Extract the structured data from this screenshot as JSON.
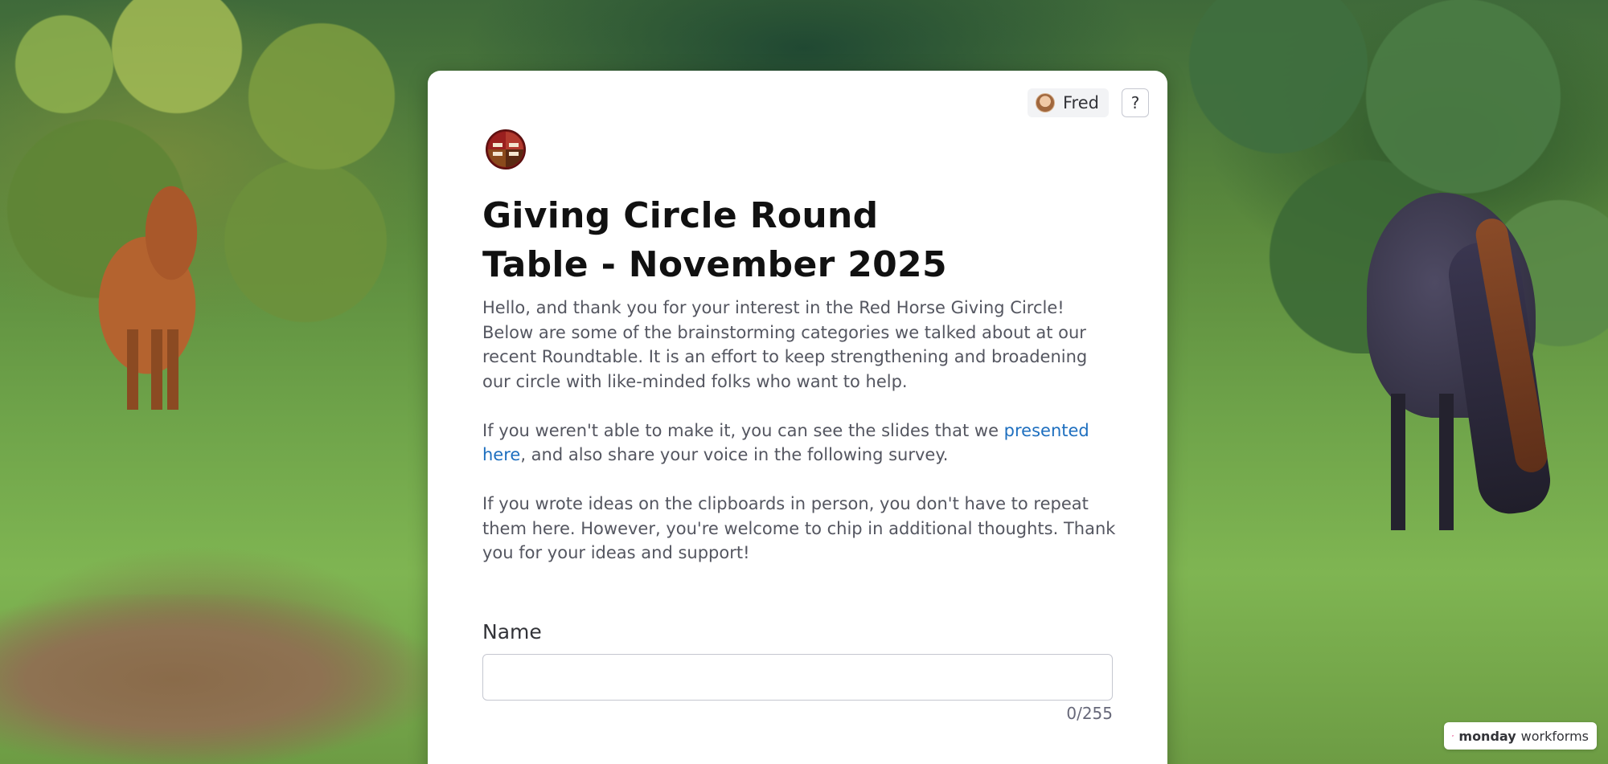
{
  "header": {
    "user_name": "Fred",
    "help_label": "?"
  },
  "form": {
    "title": "Giving Circle Round Table - November 2025",
    "paragraphs": [
      "Hello, and thank you for your interest in the Red Horse Giving Circle! Below are some of the brainstorming categories we talked about at our recent Roundtable. It is an effort to keep strengthening and broadening our circle with like-minded folks who want to help.",
      "If you weren't able to make it, you can see the slides that we ",
      "presented here",
      ", and also share your voice in the following survey.",
      "If you wrote ideas on the clipboards in person, you don't have to repeat them here. However, you're welcome to chip in additional thoughts. Thank you for your ideas and support!"
    ],
    "logo_text": "GIVING CIRCLE",
    "fields": {
      "name": {
        "label": "Name",
        "value": "",
        "placeholder": "",
        "char_count": "0/255"
      }
    }
  },
  "badge": {
    "brand": "monday",
    "product": "workforms"
  },
  "colors": {
    "link": "#1e6fbf",
    "brand_pink": "#e6357c",
    "logo_red": "#8b1a1a"
  },
  "icons": [
    "user-avatar",
    "help-icon",
    "giving-circle-logo",
    "monday-logo-icon"
  ]
}
